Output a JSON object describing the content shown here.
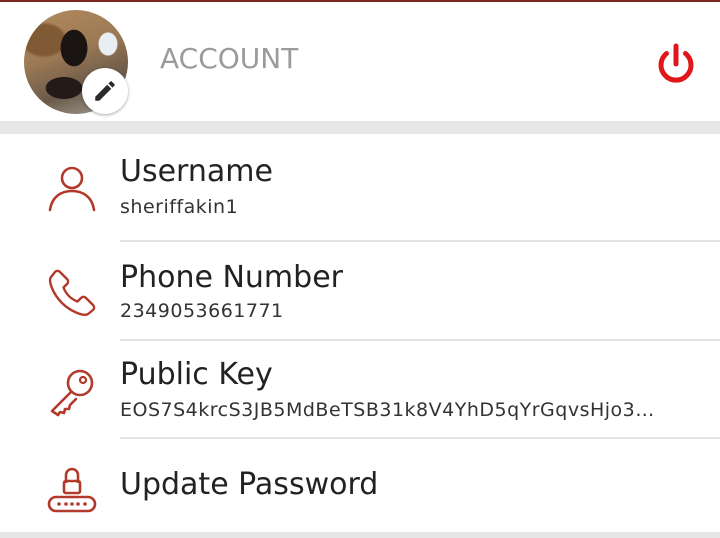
{
  "header": {
    "title": "ACCOUNT",
    "avatar_icon": "profile-photo",
    "edit_icon": "pencil-icon",
    "power_icon": "power-icon",
    "power_color": "#e0161b"
  },
  "items": [
    {
      "title": "Username",
      "value": "sheriffakin1",
      "icon": "user-icon"
    },
    {
      "title": "Phone Number",
      "value": "2349053661771",
      "icon": "phone-icon"
    },
    {
      "title": "Public Key",
      "value": "EOS7S4krcS3JB5MdBeTSB31k8V4YhD5qYrGqvsHjo3…",
      "icon": "key-icon"
    },
    {
      "title": "Update Password",
      "icon": "lock-keyboard-icon"
    }
  ],
  "accent_color": "#b23a2b"
}
